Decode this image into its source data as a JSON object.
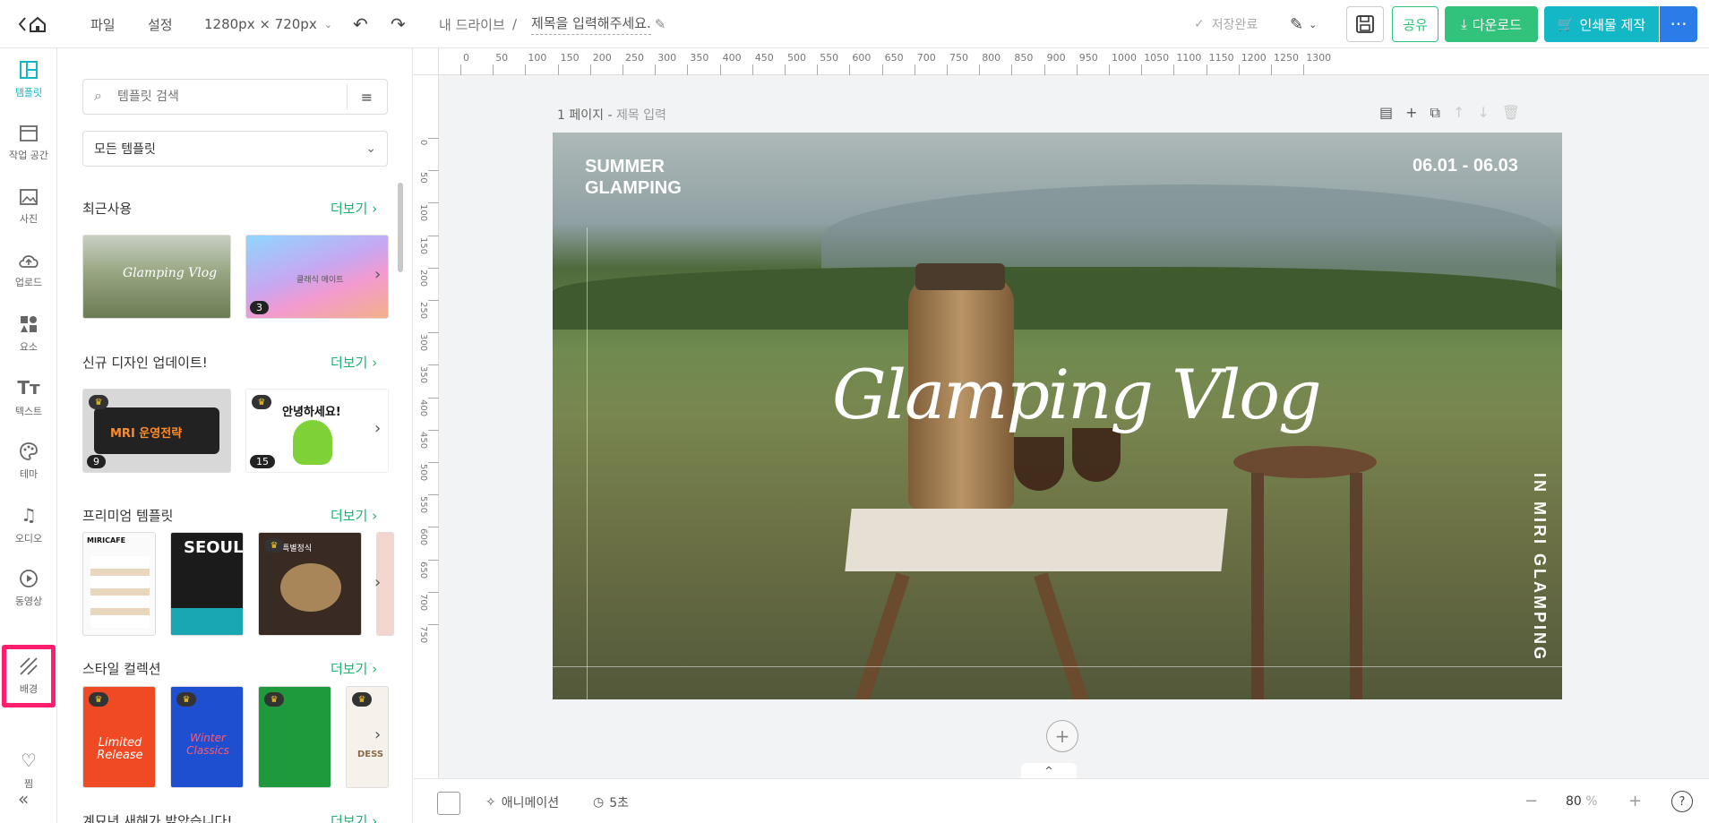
{
  "topbar": {
    "back_label": "",
    "menu_file": "파일",
    "menu_settings": "설정",
    "canvas_size": "1280px × 720px",
    "breadcrumb_drive": "내 드라이브",
    "breadcrumb_sep": "/",
    "title_placeholder": "제목을 입력해주세요.",
    "save_status": "저장완료",
    "share_label": "공유",
    "download_label": "다운로드",
    "print_label": "인쇄물 제작",
    "colors": {
      "download_bg": "#31c27b",
      "print_bg": "#13b7c6",
      "more_bg": "#2b7ce9"
    }
  },
  "rail": {
    "items": [
      {
        "label": "템플릿",
        "icon": "template-icon"
      },
      {
        "label": "작업 공간",
        "icon": "workspace-icon"
      },
      {
        "label": "사진",
        "icon": "photo-icon"
      },
      {
        "label": "업로드",
        "icon": "upload-icon"
      },
      {
        "label": "요소",
        "icon": "elements-icon"
      },
      {
        "label": "텍스트",
        "icon": "text-icon"
      },
      {
        "label": "테마",
        "icon": "palette-icon"
      },
      {
        "label": "오디오",
        "icon": "music-icon"
      },
      {
        "label": "동영상",
        "icon": "video-icon"
      },
      {
        "label": "배경",
        "icon": "background-icon"
      },
      {
        "label": "찜",
        "icon": "heart-icon"
      }
    ],
    "collapse": "«",
    "accent": "#12b7c7",
    "highlight": "#ff1e6d"
  },
  "panel": {
    "search_placeholder": "템플릿 검색",
    "filter_select": "모든 템플릿",
    "more_label": "더보기",
    "sections": [
      {
        "title": "최근사용",
        "thumbs": [
          {
            "text": "Glamping Vlog",
            "count": ""
          },
          {
            "text": "클래식 메이트",
            "count": "3"
          }
        ]
      },
      {
        "title": "신규 디자인 업데이트!",
        "thumbs": [
          {
            "text": "MRI 운영전략",
            "count": "9"
          },
          {
            "text": "안녕하세요!",
            "count": "15"
          }
        ]
      },
      {
        "title": "프리미엄 템플릿",
        "thumbs": [
          {
            "text": "MIRICAFE"
          },
          {
            "text": "SEOUL"
          },
          {
            "text": "특별정식"
          }
        ]
      },
      {
        "title": "스타일 컬렉션",
        "thumbs": [
          {
            "text": "Limited Release"
          },
          {
            "text": "Winter Classics"
          },
          {
            "text": ""
          },
          {
            "text": "DESS"
          }
        ]
      },
      {
        "title": "계묘년 새해가 밝았습니다!"
      }
    ]
  },
  "ruler": {
    "top": [
      "0",
      "50",
      "100",
      "150",
      "200",
      "250",
      "300",
      "350",
      "400",
      "450",
      "500",
      "550",
      "600",
      "650",
      "700",
      "750",
      "800",
      "850",
      "900",
      "950",
      "1000",
      "1050",
      "1100",
      "1150",
      "1200",
      "1250",
      "1300"
    ],
    "left": [
      "0",
      "50",
      "100",
      "150",
      "200",
      "250",
      "300",
      "350",
      "400",
      "450",
      "500",
      "550",
      "600",
      "650",
      "700",
      "750"
    ]
  },
  "page": {
    "page_label": "1 페이지",
    "title_sep": "-",
    "title_input": "제목 입력",
    "design": {
      "summer": "SUMMER",
      "glamping": "GLAMPING",
      "dates": "06.01 - 06.03",
      "script_title": "Glamping Vlog",
      "vertical": "IN MIRI GLAMPING"
    },
    "add_page": "+"
  },
  "bottombar": {
    "animation_label": "애니메이션",
    "duration_label": "5초",
    "zoom_value": "80",
    "zoom_unit": "%",
    "zoom_minus": "−",
    "zoom_plus": "+",
    "help": "?"
  }
}
